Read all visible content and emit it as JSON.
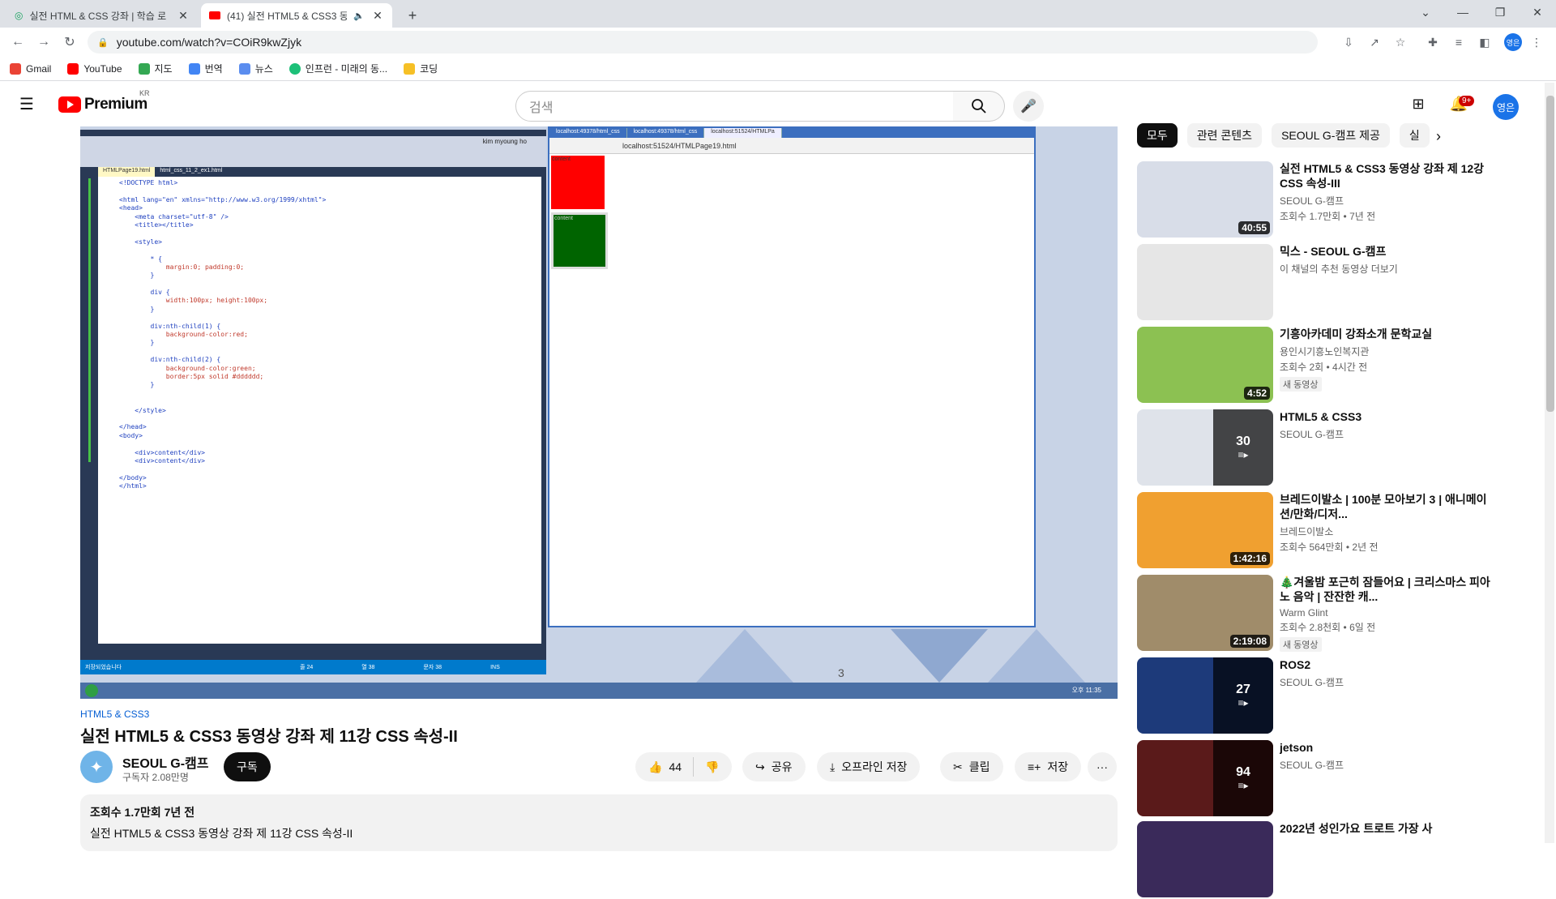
{
  "browser": {
    "tabs": [
      {
        "title": "실전 HTML & CSS 강좌 | 학습 로",
        "active": false
      },
      {
        "title": "(41) 실전 HTML5 & CSS3 동",
        "active": true
      }
    ],
    "new_tab": "+",
    "url": "youtube.com/watch?v=COiR9kwZjyk",
    "profile_initials": "영은",
    "bookmarks": [
      "Gmail",
      "YouTube",
      "지도",
      "번역",
      "뉴스",
      "인프런 - 미래의 동...",
      "코딩"
    ]
  },
  "youtube": {
    "logo_text": "Premium",
    "logo_region": "KR",
    "search_placeholder": "검색",
    "notif_badge": "9+",
    "user_initials": "영은"
  },
  "player": {
    "slide_number": "3",
    "vs_tab_active": "HTMLPage19.html",
    "vs_tab_other": "html_css_11_2_ex1.html",
    "vs_code": [
      "<!DOCTYPE html>",
      "",
      "<html lang=\"en\" xmlns=\"http://www.w3.org/1999/xhtml\">",
      "<head>",
      "    <meta charset=\"utf-8\" />",
      "    <title></title>",
      "",
      "    <style>",
      "",
      "        * {",
      "            margin:0; padding:0;",
      "        }",
      "",
      "        div {",
      "            width:100px; height:100px;",
      "        }",
      "",
      "        div:nth-child(1) {",
      "            background-color:red;",
      "        }",
      "",
      "        div:nth-child(2) {",
      "            background-color:green;",
      "            border:5px solid #dddddd;",
      "        }",
      "",
      "",
      "    </style>",
      "",
      "</head>",
      "<body>",
      "",
      "    <div>content</div>",
      "    <div>content</div>",
      "",
      "</body>",
      "</html>"
    ],
    "vs_status": [
      "저장되었습니다",
      "줄 24",
      "열 38",
      "문자 38",
      "INS"
    ],
    "vs_user": "kim myoung ho",
    "browser_tabs": [
      "localhost:49378/html_css",
      "localhost:49378/html_css",
      "localhost:51524/HTMLPa"
    ],
    "browser_url": "localhost:51524/HTMLPage19.html",
    "box_label": "content",
    "taskbar_time": "오후 11:35"
  },
  "video": {
    "hashtag": "HTML5 & CSS3",
    "title": "실전 HTML5 & CSS3 동영상 강좌 제 11강 CSS 속성-II",
    "channel": "SEOUL G-캠프",
    "subscribers": "구독자 2.08만명",
    "subscribe_label": "구독",
    "likes": "44",
    "share_label": "공유",
    "download_label": "오프라인 저장",
    "clip_label": "클립",
    "save_label": "저장",
    "more_label": "···",
    "desc_stats": "조회수 1.7만회  7년 전",
    "desc_text": "실전 HTML5 & CSS3 동영상 강좌 제 11강 CSS 속성-II"
  },
  "sidebar": {
    "chips": [
      "모두",
      "관련 콘텐츠",
      "SEOUL G-캠프 제공",
      "실"
    ],
    "items": [
      {
        "title": "실전 HTML5 & CSS3 동영상 강좌 제 12강 CSS 속성-III",
        "channel": "SEOUL G-캠프",
        "views": "조회수 1.7만회 • 7년 전",
        "duration": "40:55",
        "thumb": "#d8dde8"
      },
      {
        "title": "믹스 - SEOUL G-캠프",
        "channel": "이 채널의 추천 동영상 더보기",
        "views": "",
        "duration": "",
        "thumb": "#e6e6e6"
      },
      {
        "title": "기흥아카데미 강좌소개 문학교실",
        "channel": "용인시기흥노인복지관",
        "views": "조회수 2회 • 4시간 전",
        "duration": "4:52",
        "badge": "새 동영상",
        "thumb": "#8cc152"
      },
      {
        "title": "HTML5 & CSS3",
        "channel": "SEOUL G-캠프",
        "views": "",
        "playlist_count": "30",
        "thumb": "#dfe3ea"
      },
      {
        "title": "브레드이발소 | 100분 모아보기 3 | 애니메이션/만화/디저...",
        "channel": "브레드이발소",
        "views": "조회수 564만회 • 2년 전",
        "duration": "1:42:16",
        "thumb": "#f0a030"
      },
      {
        "title": "🎄겨울밤 포근히 잠들어요 | 크리스마스 피아노 음악 | 잔잔한 캐...",
        "channel": "Warm Glint",
        "views": "조회수 2.8천회 • 6일 전",
        "duration": "2:19:08",
        "badge": "새 동영상",
        "thumb": "#a08c6a"
      },
      {
        "title": "ROS2",
        "channel": "SEOUL G-캠프",
        "views": "",
        "playlist_count": "27",
        "thumb": "#1d3a7a"
      },
      {
        "title": "jetson",
        "channel": "SEOUL G-캠프",
        "views": "",
        "playlist_count": "94",
        "thumb": "#5a1a1a"
      },
      {
        "title": "2022년 성인가요 트로트 가장 사",
        "channel": "",
        "views": "",
        "duration": "",
        "thumb": "#3a2a5a"
      }
    ]
  }
}
